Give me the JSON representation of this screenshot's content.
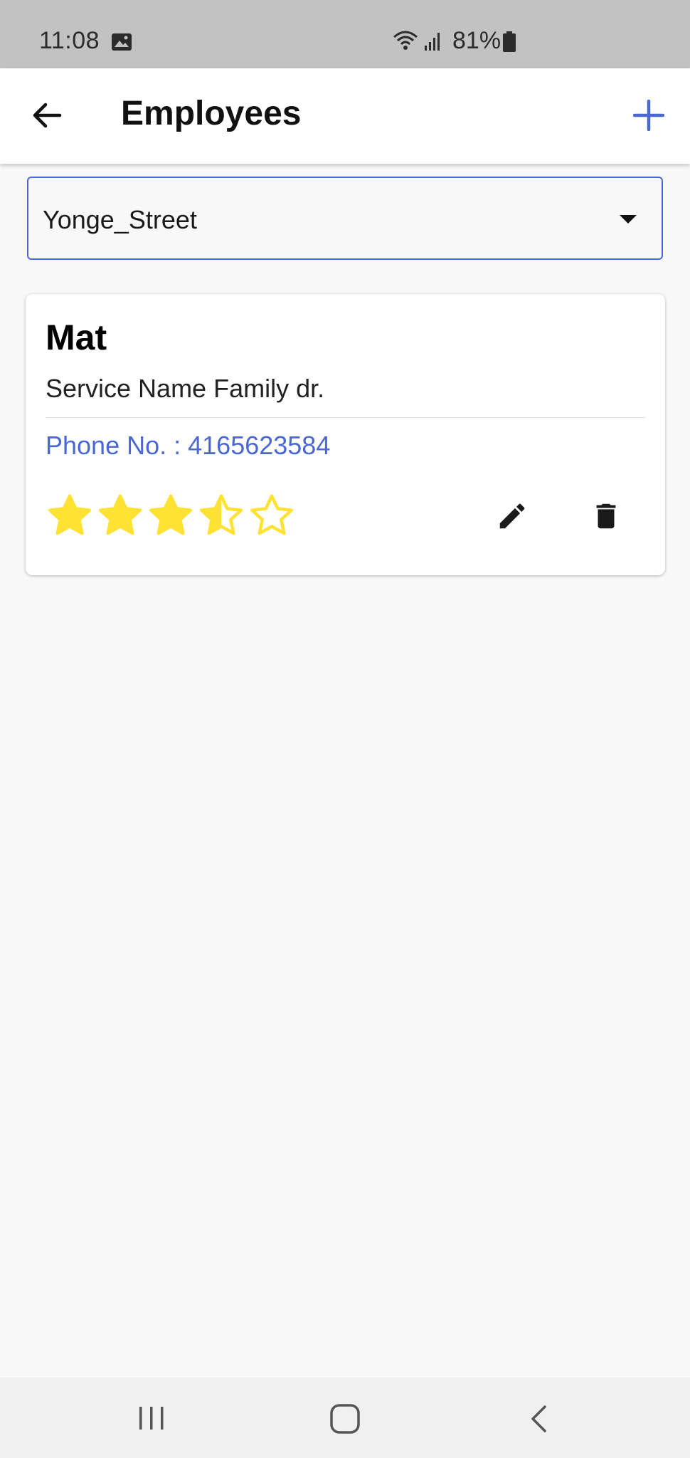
{
  "status_bar": {
    "time": "11:08",
    "battery": "81%",
    "icons": [
      "gallery-icon",
      "wifi-icon",
      "signal-icon",
      "battery-icon"
    ]
  },
  "app_bar": {
    "title": "Employees",
    "back_icon": "arrow-left-icon",
    "add_icon": "plus-icon",
    "accent_color": "#4a67d6"
  },
  "location_select": {
    "selected": "Yonge_Street",
    "icon": "caret-down-icon"
  },
  "employees": [
    {
      "name": "Mat",
      "service": "Service Name Family dr.",
      "phone": "Phone No. : 4165623584",
      "rating": 3.5,
      "rating_max": 5,
      "star_color": "#ffe234",
      "actions": [
        "pencil-icon",
        "trash-icon"
      ]
    }
  ],
  "nav_bar": {
    "icons": [
      "recents-icon",
      "home-icon",
      "back-icon"
    ]
  }
}
